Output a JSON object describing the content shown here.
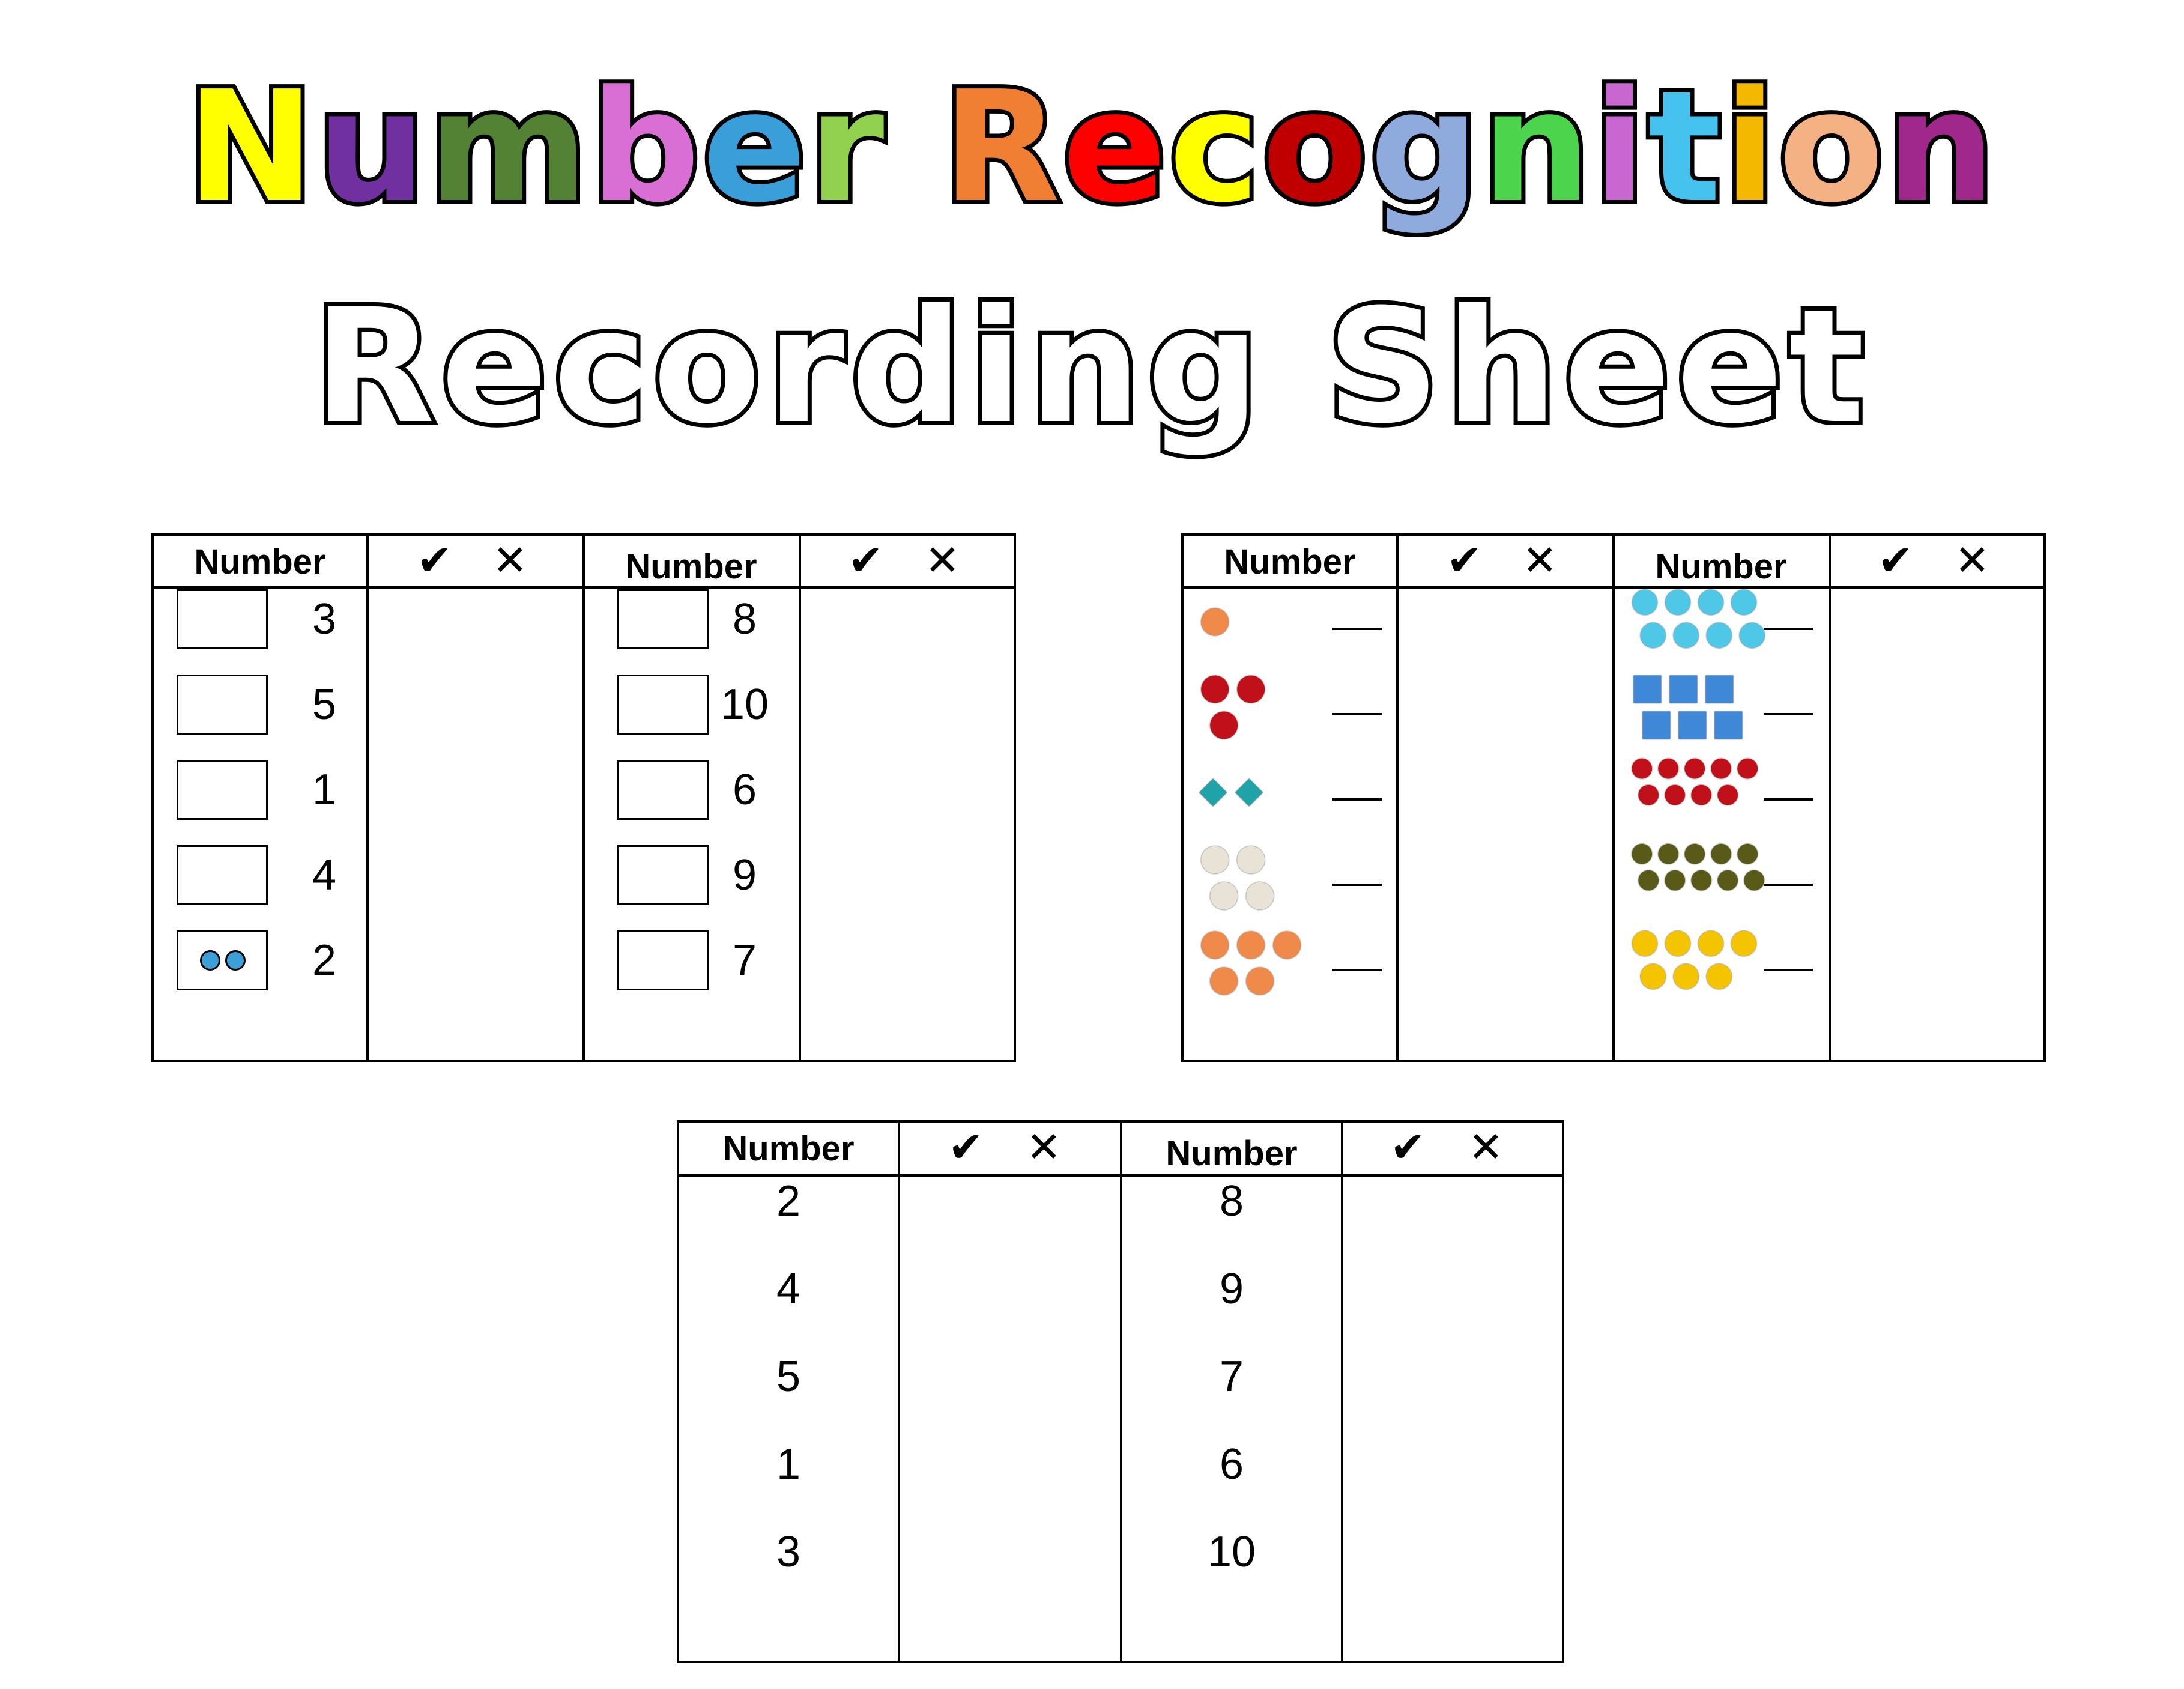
{
  "title": {
    "line1": "Number Recognition",
    "line1_colors": [
      "#ffff00",
      "#7030a0",
      "#548235",
      "#d96fd4",
      "#3a9fd8",
      "#92d050",
      "#ffffff",
      "#f07f33",
      "#ff0000",
      "#ffff00",
      "#c00000",
      "#8faadc",
      "#4cd44c",
      "#c967d1",
      "#46c2ee",
      "#f5b800",
      "#f4b183",
      "#a0278c",
      "#92d050"
    ],
    "line2": "Recording Sheet"
  },
  "common": {
    "header_number": "Number",
    "check_icon": "check-icon",
    "cross_icon": "cross-icon",
    "check_glyph": "✔",
    "cross_glyph": "✕"
  },
  "table_boxes": {
    "left_numbers": [
      "3",
      "5",
      "1",
      "4",
      "2"
    ],
    "right_numbers": [
      "8",
      "10",
      "6",
      "9",
      "7"
    ],
    "example_dots": 2,
    "dot_color": "#3d9fd8"
  },
  "table_pictures": {
    "left_items": [
      {
        "icon": "peach-icon",
        "count": 1
      },
      {
        "icon": "cherry-icon",
        "count": 3
      },
      {
        "icon": "butterfly-icon",
        "count": 2
      },
      {
        "icon": "garlic-icon",
        "count": 4
      },
      {
        "icon": "peach-icon",
        "count": 5
      }
    ],
    "right_items": [
      {
        "icon": "bird-icon",
        "count": 8
      },
      {
        "icon": "ice-cube-icon",
        "count": 6
      },
      {
        "icon": "cherry-icon",
        "count": 9
      },
      {
        "icon": "olive-icon",
        "count": 10
      },
      {
        "icon": "yellow-apple-icon",
        "count": 7
      }
    ]
  },
  "table_plain": {
    "left_numbers": [
      "2",
      "4",
      "5",
      "1",
      "3"
    ],
    "right_numbers": [
      "8",
      "9",
      "7",
      "6",
      "10"
    ]
  }
}
